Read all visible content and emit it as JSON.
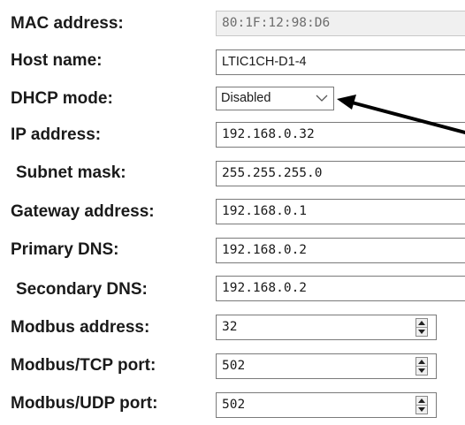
{
  "rows": [
    {
      "label": "MAC address:",
      "value": "80:1F:12:98:D6"
    },
    {
      "label": "Host name:",
      "value": "LTIC1CH-D1-4"
    },
    {
      "label": "DHCP mode:",
      "value": "Disabled"
    },
    {
      "label": "IP address:",
      "value": "192.168.0.32"
    },
    {
      "label": "Subnet mask:",
      "value": "255.255.255.0"
    },
    {
      "label": "Gateway address:",
      "value": "192.168.0.1"
    },
    {
      "label": "Primary DNS:",
      "value": "192.168.0.2"
    },
    {
      "label": "Secondary DNS:",
      "value": "192.168.0.2"
    },
    {
      "label": "Modbus address:",
      "value": "32"
    },
    {
      "label": "Modbus/TCP port:",
      "value": "502"
    },
    {
      "label": "Modbus/UDP port:",
      "value": "502"
    }
  ],
  "icons": {
    "dropdown": "chevron-down-icon",
    "spinner_up": "spinner-up-icon",
    "spinner_down": "spinner-down-icon",
    "annotation": "arrow-annotation"
  },
  "colors": {
    "arrow": "#000000",
    "readonly_bg": "#f0f0f0"
  }
}
